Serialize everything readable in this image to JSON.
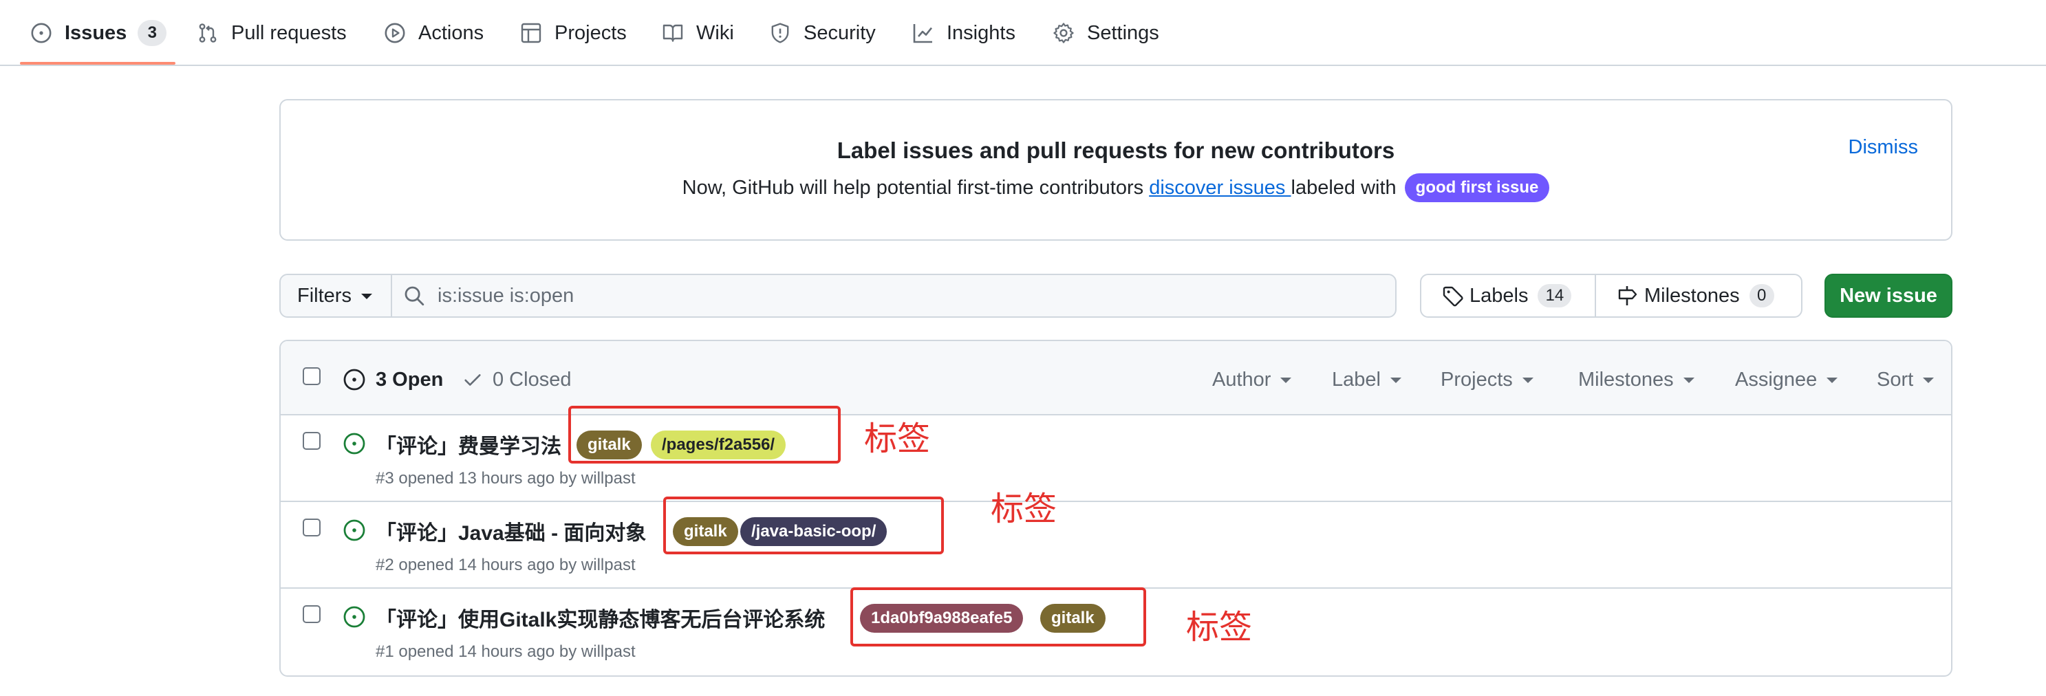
{
  "nav": {
    "items": [
      {
        "label": "Issues",
        "count": "3",
        "icon": "issue-opened-icon",
        "selected": true
      },
      {
        "label": "Pull requests",
        "icon": "git-pull-request-icon"
      },
      {
        "label": "Actions",
        "icon": "play-icon"
      },
      {
        "label": "Projects",
        "icon": "table-icon"
      },
      {
        "label": "Wiki",
        "icon": "book-icon"
      },
      {
        "label": "Security",
        "icon": "shield-icon"
      },
      {
        "label": "Insights",
        "icon": "graph-icon"
      },
      {
        "label": "Settings",
        "icon": "gear-icon"
      }
    ],
    "underline_color": "#fd8c73"
  },
  "banner": {
    "title": "Label issues and pull requests for new contributors",
    "text_before": "Now, GitHub will help potential first-time contributors ",
    "link": "discover issues ",
    "text_after": "labeled with",
    "label": "good first issue",
    "label_color": "#7057ff",
    "dismiss": "Dismiss"
  },
  "toolbar": {
    "filters": "Filters",
    "search_value": "is:issue is:open",
    "labels": "Labels",
    "labels_count": "14",
    "milestones": "Milestones",
    "milestones_count": "0",
    "new_issue": "New issue",
    "new_issue_color": "#1f883d"
  },
  "issues_header": {
    "open": "3 Open",
    "closed": "0 Closed",
    "filters": [
      "Author",
      "Label",
      "Projects",
      "Milestones",
      "Assignee",
      "Sort"
    ]
  },
  "issues": [
    {
      "title": "「评论」费曼学习法",
      "meta": "#3 opened 13 hours ago by ",
      "author": "willpast",
      "labels": [
        {
          "name": "gitalk",
          "bg": "#7a6930",
          "fg": "#ffffff"
        },
        {
          "name": "/pages/f2a556/",
          "bg": "#d7e362",
          "fg": "#1f2328"
        }
      ]
    },
    {
      "title": "「评论」Java基础 - 面向对象",
      "meta": "#2 opened 14 hours ago by ",
      "author": "willpast",
      "labels": [
        {
          "name": "gitalk",
          "bg": "#7a6930",
          "fg": "#ffffff"
        },
        {
          "name": "/java-basic-oop/",
          "bg": "#3f3d5c",
          "fg": "#ffffff"
        }
      ]
    },
    {
      "title": "「评论」使用Gitalk实现静态博客无后台评论系统",
      "meta": "#1 opened 14 hours ago by ",
      "author": "willpast",
      "labels": [
        {
          "name": "1da0bf9a988eafe5",
          "bg": "#8c4a5a",
          "fg": "#ffffff"
        },
        {
          "name": "gitalk",
          "bg": "#7a6930",
          "fg": "#ffffff"
        }
      ]
    }
  ],
  "annotations": {
    "text": "标签",
    "color": "#e5322d"
  },
  "colors": {
    "open_icon": "#1a7f37",
    "link": "#0969da",
    "border": "#d0d7de"
  }
}
